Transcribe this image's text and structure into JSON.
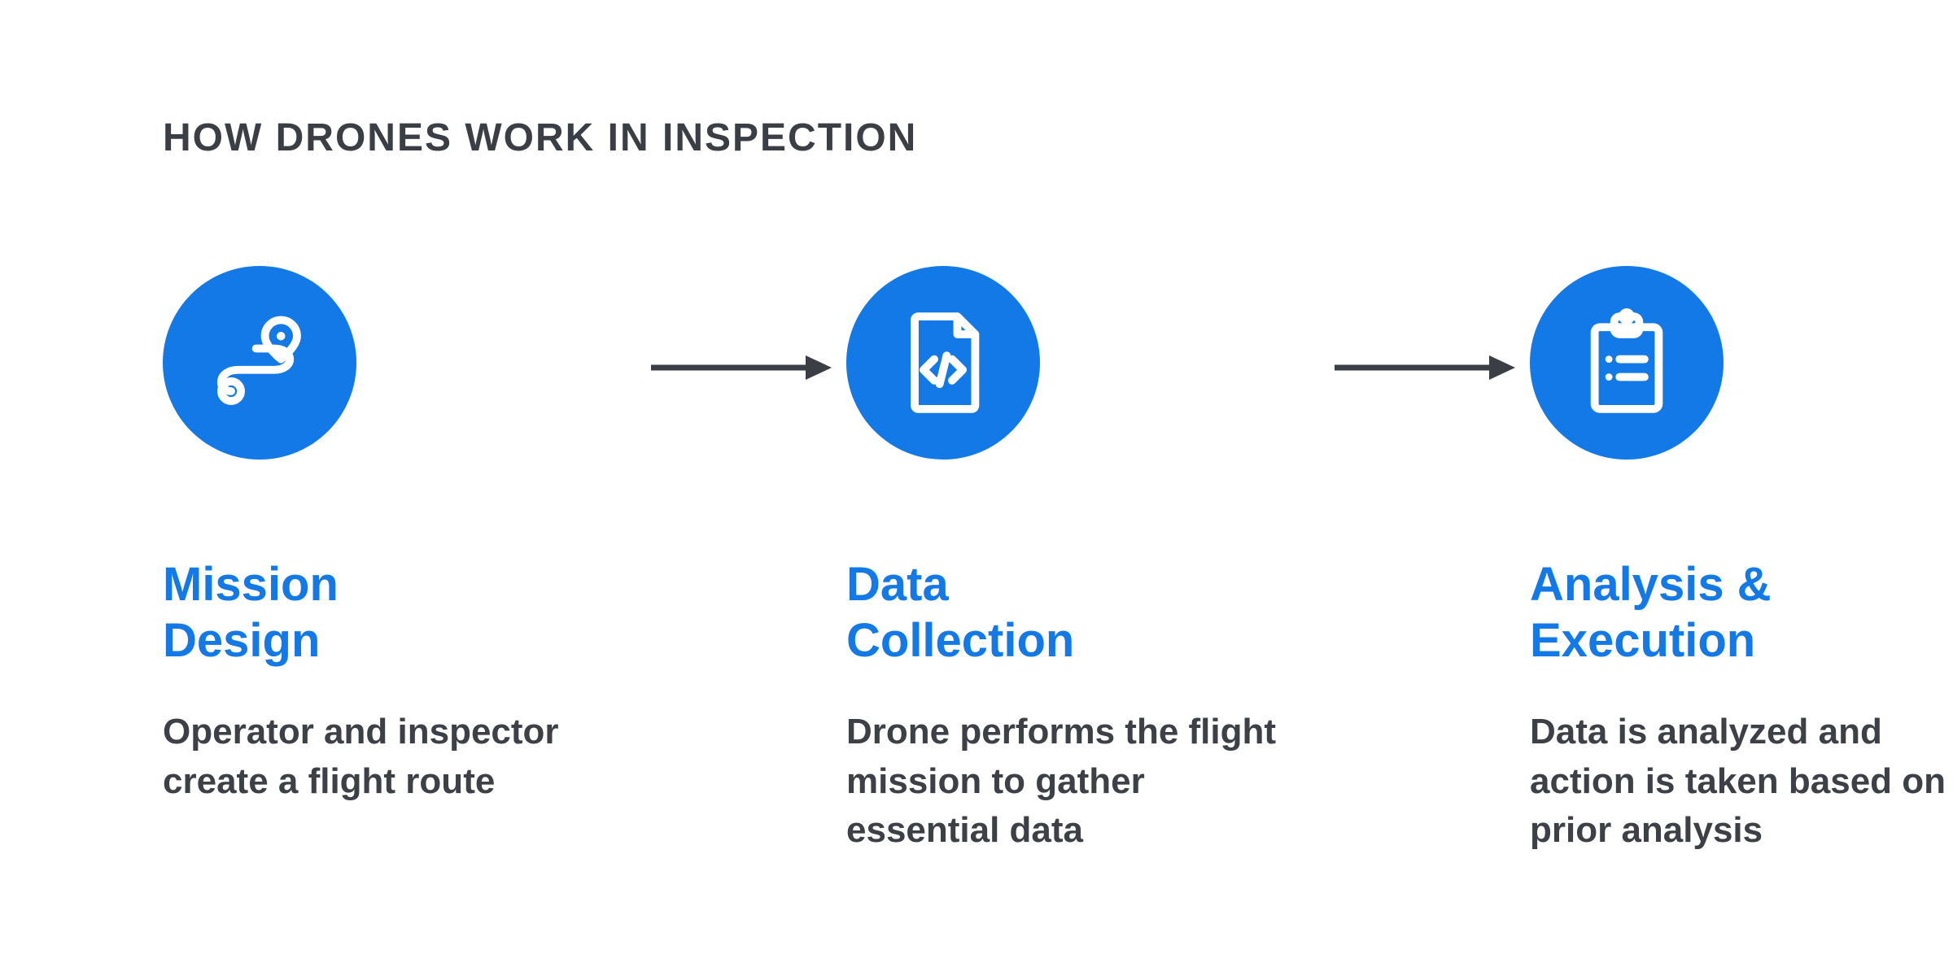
{
  "heading": "HOW DRONES WORK IN INSPECTION",
  "steps": [
    {
      "title": "Mission\nDesign",
      "description": "Operator and inspector create a flight route",
      "icon": "route-icon"
    },
    {
      "title": "Data\nCollection",
      "description": "Drone performs the flight mission to gather essential data",
      "icon": "code-file-icon"
    },
    {
      "title": "Analysis &\nExecution",
      "description": "Data is analyzed and action is taken based on prior analysis",
      "icon": "clipboard-list-icon"
    }
  ],
  "colors": {
    "accent": "#1279e6",
    "text": "#3b3f45"
  }
}
